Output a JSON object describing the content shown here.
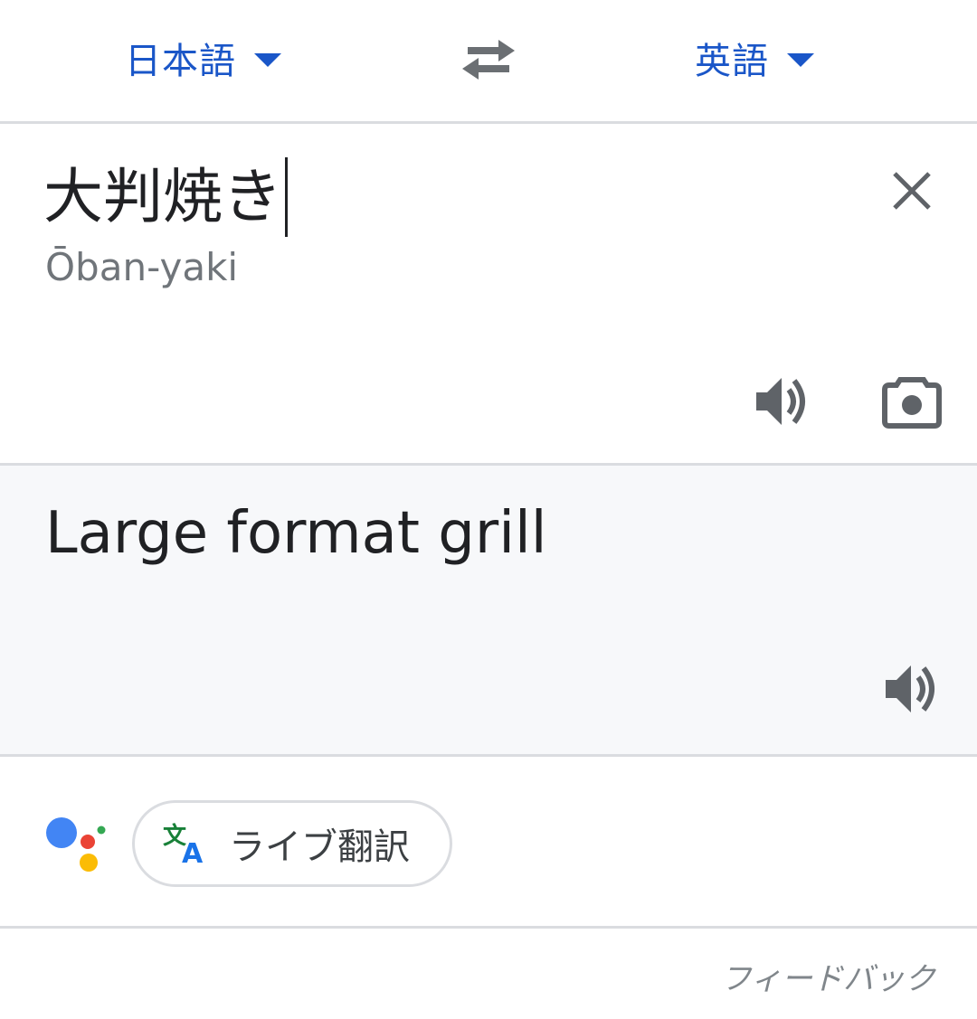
{
  "language_bar": {
    "source_language": "日本語",
    "target_language": "英語"
  },
  "source": {
    "text": "大判焼き",
    "transliteration": "Ōban-yaki"
  },
  "target": {
    "text": "Large format grill"
  },
  "actions": {
    "live_translate_label": "ライブ翻訳"
  },
  "footer": {
    "feedback_label": "フィードバック"
  },
  "icons": {
    "swap": "swap-arrows-icon",
    "clear": "close-icon",
    "speaker": "speaker-icon",
    "camera": "camera-icon",
    "assistant": "google-assistant-icon",
    "translate": "translate-icon"
  },
  "colors": {
    "accent": "#1a56c8",
    "text": "#202124",
    "muted": "#70757a",
    "divider": "#dadce0",
    "translation_bg": "#f7f8fa"
  }
}
